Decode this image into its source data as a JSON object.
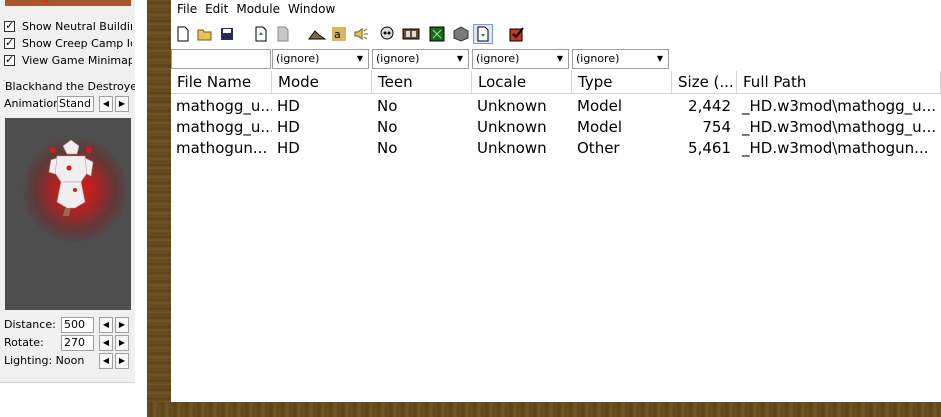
{
  "options": {
    "show_neutral_building": "Show Neutral Building I",
    "show_creep_camp": "Show Creep Camp Icor",
    "view_game_minimap": "View Game Minimap"
  },
  "preview": {
    "group_title": "Blackhand the Destroyer",
    "animation_label": "Animation:",
    "animation_value": "Stand '",
    "distance_label": "Distance:",
    "distance_value": "500",
    "rotate_label": "Rotate:",
    "rotate_value": "270",
    "lighting_label": "Lighting: Noon"
  },
  "menu": [
    "File",
    "Edit",
    "Module",
    "Window"
  ],
  "toolbar_icons": [
    "new-file-icon",
    "open-folder-icon",
    "save-icon",
    "export-icon",
    "document-icon",
    "terrain-icon",
    "text-icon",
    "sound-icon",
    "skull-icon",
    "film-icon",
    "map-icon",
    "cube-icon",
    "filter-icon",
    "checklist-icon"
  ],
  "filters": {
    "search_value": "",
    "mode": "(ignore)",
    "teen": "(ignore)",
    "locale": "(ignore)",
    "type": "(ignore)"
  },
  "table": {
    "columns": [
      "File Name",
      "Mode",
      "Teen",
      "Locale",
      "Type",
      "Size (...",
      "Full Path"
    ],
    "rows": [
      [
        "mathogg_u...",
        "HD",
        "No",
        "Unknown",
        "Model",
        "2,442",
        "_HD.w3mod\\mathogg_u..."
      ],
      [
        "mathogg_u...",
        "HD",
        "No",
        "Unknown",
        "Model",
        "754",
        "_HD.w3mod\\mathogg_u..."
      ],
      [
        "mathogun...",
        "HD",
        "No",
        "Unknown",
        "Other",
        "5,461",
        "_HD.w3mod\\mathogun..."
      ]
    ]
  },
  "colors": {
    "panel": "#f0f0f0",
    "wood": "#6b4f1e",
    "viewport": "#4e4e4e",
    "glow": "#e21b1b"
  }
}
